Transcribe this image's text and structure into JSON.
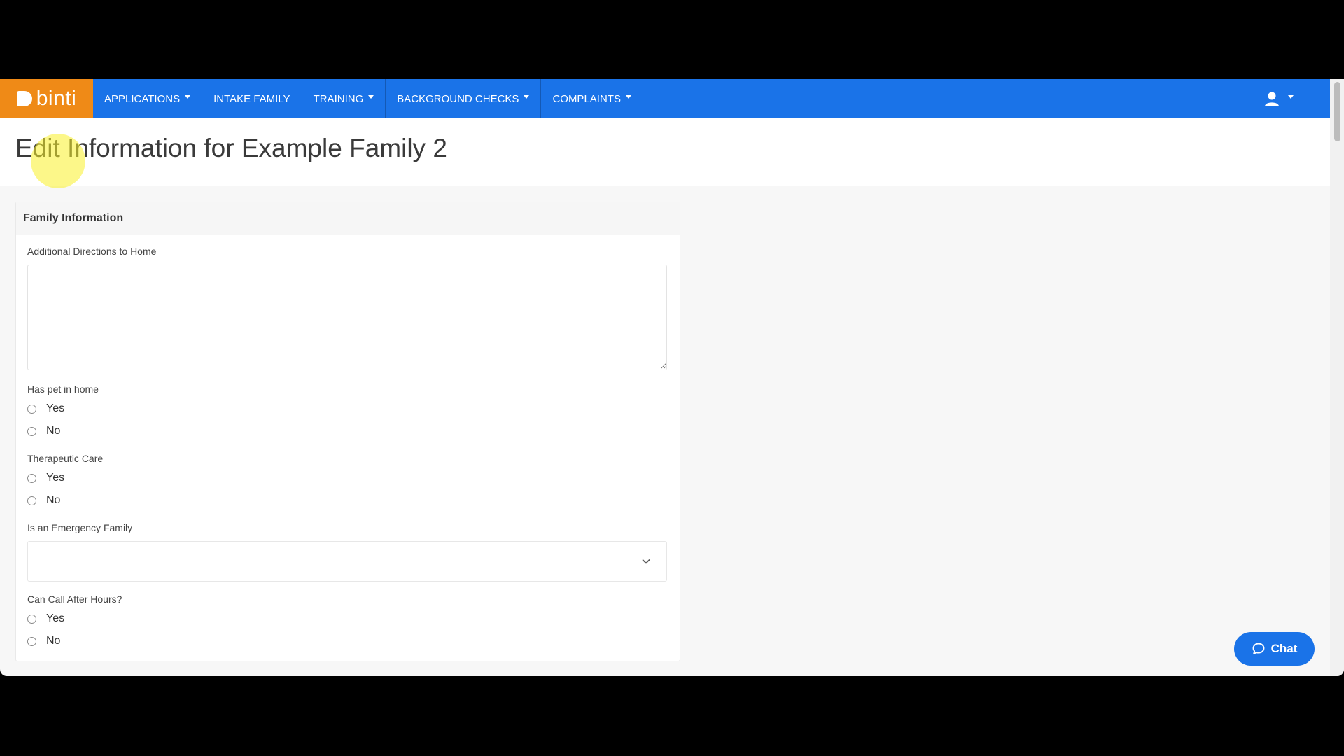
{
  "navbar": {
    "brand": "binti",
    "items": [
      {
        "label": "APPLICATIONS",
        "has_caret": true
      },
      {
        "label": "INTAKE FAMILY",
        "has_caret": false
      },
      {
        "label": "TRAINING",
        "has_caret": true
      },
      {
        "label": "BACKGROUND CHECKS",
        "has_caret": true
      },
      {
        "label": "COMPLAINTS",
        "has_caret": true
      }
    ],
    "user_icon": "user-icon"
  },
  "page": {
    "title": "Edit Information for Example Family 2"
  },
  "form": {
    "section_title": "Family Information",
    "directions": {
      "label": "Additional Directions to Home",
      "value": ""
    },
    "has_pet": {
      "label": "Has pet in home",
      "options": [
        "Yes",
        "No"
      ]
    },
    "therapeutic_care": {
      "label": "Therapeutic Care",
      "options": [
        "Yes",
        "No"
      ]
    },
    "emergency_family": {
      "label": "Is an Emergency Family",
      "value": ""
    },
    "call_after_hours": {
      "label": "Can Call After Hours?",
      "options": [
        "Yes",
        "No"
      ]
    }
  },
  "chat": {
    "label": "Chat",
    "icon": "chat-bubble-icon"
  },
  "colors": {
    "nav_blue": "#1a73e8",
    "brand_orange": "#ef8a17"
  }
}
